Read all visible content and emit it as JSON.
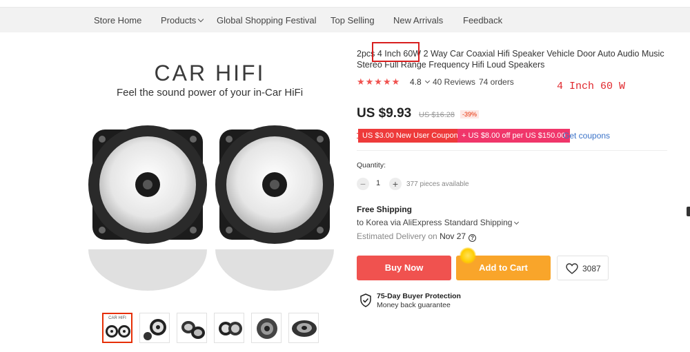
{
  "nav": {
    "items": [
      {
        "label": "Store Home"
      },
      {
        "label": "Products"
      },
      {
        "label": "Global Shopping Festival"
      },
      {
        "label": "Top Selling"
      },
      {
        "label": "New Arrivals"
      },
      {
        "label": "Feedback"
      }
    ]
  },
  "gallery": {
    "headline": "CAR HIFI",
    "subline": "Feel the sound power of your in-Car HiFi",
    "thumb_caption": "CAR HIFI",
    "thumb_count": 6,
    "selected_thumb": 1
  },
  "product": {
    "title": "2pcs 4 Inch 60W 2 Way Car Coaxial Hifi Speaker Vehicle Door Auto Audio Music Stereo Full Range Frequency Hifi Loud Speakers",
    "annotation": "4 Inch 60 W",
    "stars": "★★★★★",
    "rating": "4.8",
    "reviews": "40 Reviews",
    "orders": "74 orders",
    "price": "US $9.93",
    "old_price": "US $16.28",
    "discount": "-39%",
    "coupon_new_user": "US $3.00 New User Coupon",
    "coupon_store": "+ US $8.00 off per US $150.00",
    "get_coupons": "Get coupons"
  },
  "quantity": {
    "label": "Quantity:",
    "minus": "−",
    "value": "1",
    "plus": "+",
    "available": "377 pieces available"
  },
  "shipping": {
    "heading": "Free Shipping",
    "to": "to Korea via AliExpress Standard Shipping",
    "estimated_label": "Estimated Delivery on",
    "estimated_date": "Nov 27",
    "help": "?"
  },
  "actions": {
    "buy_now": "Buy Now",
    "add_to_cart": "Add to Cart",
    "wishlist_count": "3087"
  },
  "protection": {
    "title": "75-Day Buyer Protection",
    "subtitle": "Money back guarantee"
  },
  "colors": {
    "accent_red": "#f0524f",
    "cart_orange": "#f9a52a",
    "coupon_red": "#ee3a3a",
    "coupon_pink": "#f0366a",
    "link_blue": "#3b73c8",
    "annotation_red": "#e0262b"
  }
}
